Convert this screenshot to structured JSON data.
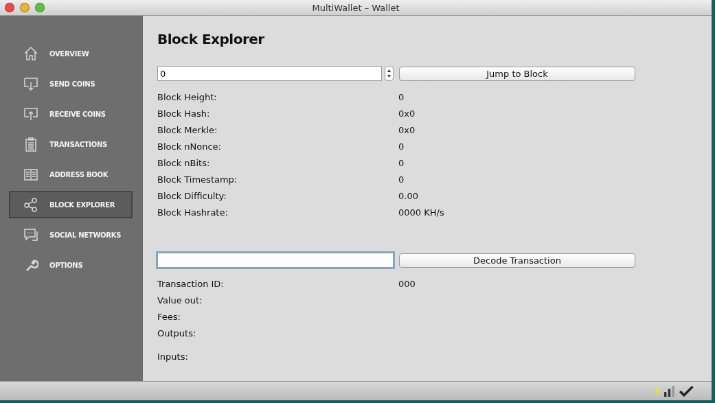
{
  "window": {
    "title": "MultiWallet – Wallet"
  },
  "sidebar": {
    "items": [
      {
        "label": "OVERVIEW",
        "selected": false
      },
      {
        "label": "SEND COINS",
        "selected": false
      },
      {
        "label": "RECEIVE COINS",
        "selected": false
      },
      {
        "label": "TRANSACTIONS",
        "selected": false
      },
      {
        "label": "ADDRESS BOOK",
        "selected": false
      },
      {
        "label": "BLOCK EXPLORER",
        "selected": true
      },
      {
        "label": "SOCIAL NETWORKS",
        "selected": false
      },
      {
        "label": "OPTIONS",
        "selected": false
      }
    ]
  },
  "page": {
    "title": "Block Explorer",
    "block_search": {
      "value": "0",
      "button": "Jump to Block"
    },
    "block_fields": [
      {
        "label": "Block Height:",
        "value": "0"
      },
      {
        "label": "Block Hash:",
        "value": "0x0"
      },
      {
        "label": "Block Merkle:",
        "value": "0x0"
      },
      {
        "label": "Block nNonce:",
        "value": "0"
      },
      {
        "label": "Block nBits:",
        "value": "0"
      },
      {
        "label": "Block Timestamp:",
        "value": "0"
      },
      {
        "label": "Block Difficulty:",
        "value": "0.00"
      },
      {
        "label": "Block Hashrate:",
        "value": "0000 KH/s"
      }
    ],
    "transaction_search": {
      "button": "Decode Transaction"
    },
    "transaction_fields": [
      {
        "label": "Transaction ID:",
        "value": "000"
      },
      {
        "label": "Value out:"
      },
      {
        "label": "Fees:"
      },
      {
        "label": "Outputs:"
      },
      {
        "label": "Inputs:"
      }
    ]
  }
}
